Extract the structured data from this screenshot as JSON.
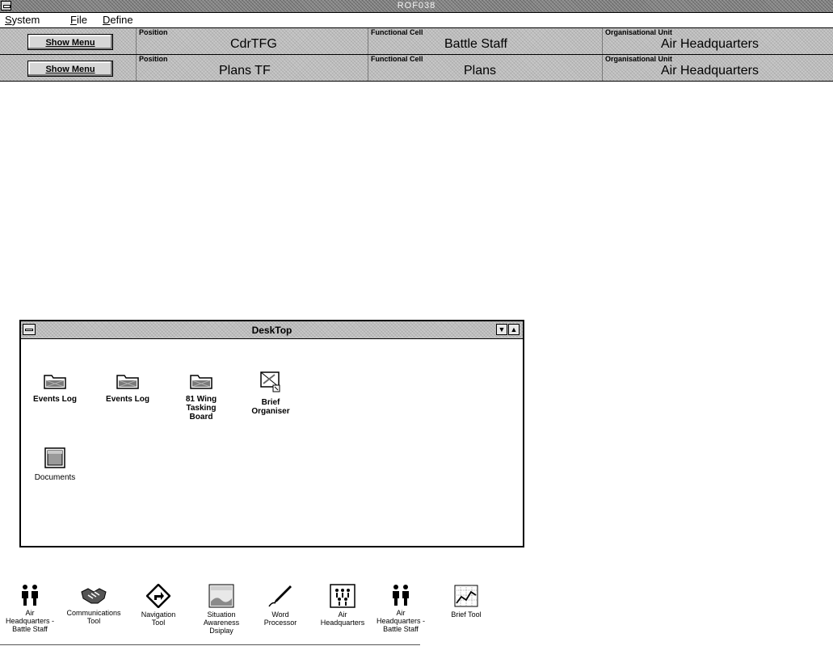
{
  "app": {
    "title": "ROF038"
  },
  "menu": {
    "items": [
      {
        "first": "S",
        "rest": "ystem"
      },
      {
        "first": "F",
        "rest": "ile"
      },
      {
        "first": "D",
        "rest": "efine"
      }
    ]
  },
  "positions": [
    {
      "show_menu_label": "Show Menu",
      "position_caption": "Position",
      "position_value": "CdrTFG",
      "cell_caption": "Functional Cell",
      "cell_value": "Battle Staff",
      "unit_caption": "Organisational Unit",
      "unit_value": "Air Headquarters"
    },
    {
      "show_menu_label": "Show Menu",
      "position_caption": "Position",
      "position_value": "Plans TF",
      "cell_caption": "Functional Cell",
      "cell_value": "Plans",
      "unit_caption": "Organisational Unit",
      "unit_value": "Air Headquarters"
    }
  ],
  "desktop_window": {
    "title": "DeskTop",
    "minimize_glyph": "▼",
    "maximize_glyph": "▲",
    "icons": [
      {
        "label_lines": [
          "Events Log"
        ],
        "icon": "folder-icon"
      },
      {
        "label_lines": [
          "Events Log"
        ],
        "icon": "folder-icon"
      },
      {
        "label_lines": [
          "81 Wing",
          "Tasking",
          "Board"
        ],
        "icon": "folder-icon"
      },
      {
        "label_lines": [
          "Brief",
          "Organiser"
        ],
        "icon": "brief-organiser-icon"
      },
      {
        "label_lines": [
          "Documents"
        ],
        "icon": "documents-icon"
      }
    ]
  },
  "tools": [
    {
      "label_lines": [
        "Air",
        "Headquarters -",
        "Battle Staff"
      ],
      "icon": "people-pair-icon"
    },
    {
      "label_lines": [
        "Communications",
        "Tool"
      ],
      "icon": "handshake-icon"
    },
    {
      "label_lines": [
        "Navigation",
        "Tool"
      ],
      "icon": "navigation-sign-icon"
    },
    {
      "label_lines": [
        "Situation",
        "Awareness",
        "Dsiplay"
      ],
      "icon": "map-display-icon"
    },
    {
      "label_lines": [
        "Word",
        "Processor"
      ],
      "icon": "pen-icon"
    },
    {
      "label_lines": [
        "Air",
        "Headquarters"
      ],
      "icon": "org-chart-icon"
    },
    {
      "label_lines": [
        "Air",
        "Headquarters -",
        "Battle Staff"
      ],
      "icon": "people-pair-icon"
    },
    {
      "label_lines": [
        "Brief Tool"
      ],
      "icon": "chart-board-icon"
    }
  ]
}
